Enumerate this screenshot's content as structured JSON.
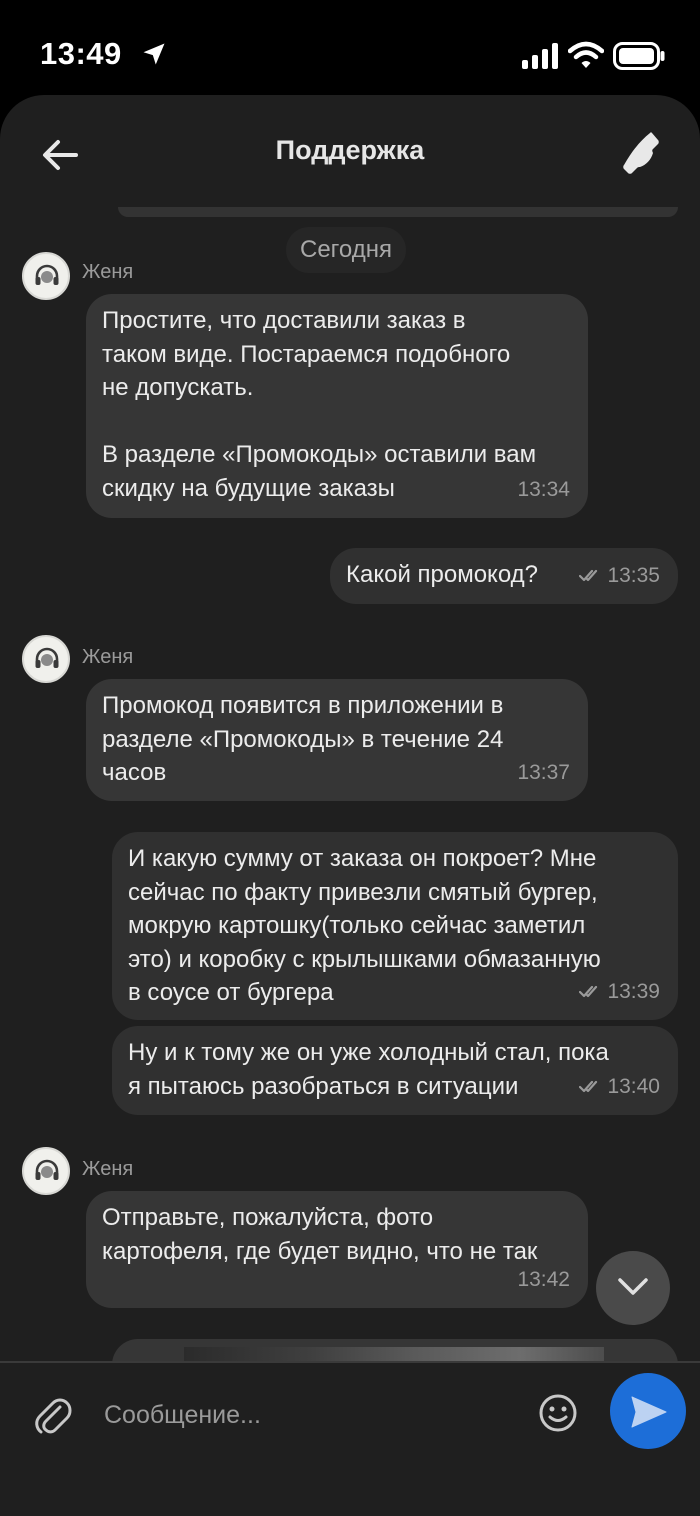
{
  "status_bar": {
    "time": "13:49"
  },
  "header": {
    "title": "Поддержка"
  },
  "chat": {
    "date_divider": "Сегодня",
    "messages": [
      {
        "sender": "Женя",
        "text": "Простите, что доставили заказ в\nтаком виде. Постараемся подобного\nне допускать.\n\nВ разделе «Промокоды» оставили вам\nскидку на будущие заказы",
        "time": "13:34"
      },
      {
        "text": "Какой промокод?",
        "time": "13:35"
      },
      {
        "sender": "Женя",
        "text": "Промокод появится в приложении в\nразделе «Промокоды» в течение 24\nчасов",
        "time": "13:37"
      },
      {
        "text": "И какую сумму от заказа он покроет? Мне\nсейчас по факту привезли смятый бургер,\nмокрую картошку(только сейчас заметил\nэто) и коробку с крылышками обмазанную\nв соусе от бургера",
        "time": "13:39"
      },
      {
        "text": "Ну и к тому же он уже холодный стал, пока\nя пытаюсь разобраться в ситуации",
        "time": "13:40"
      },
      {
        "sender": "Женя",
        "text": "Отправьте, пожалуйста, фото\nкартофеля, где будет видно, что не так",
        "time": "13:42"
      }
    ]
  },
  "composer": {
    "placeholder": "Сообщение..."
  },
  "colors": {
    "accent": "#1d6ed8",
    "background": "#1f1f1f",
    "bubble": "#363636"
  },
  "icons": [
    "location-icon",
    "signal-icon",
    "wifi-icon",
    "battery-icon",
    "back-arrow-icon",
    "phone-icon",
    "headset-icon",
    "double-check-icon",
    "chevron-down-icon",
    "paperclip-icon",
    "smiley-icon",
    "send-icon"
  ]
}
